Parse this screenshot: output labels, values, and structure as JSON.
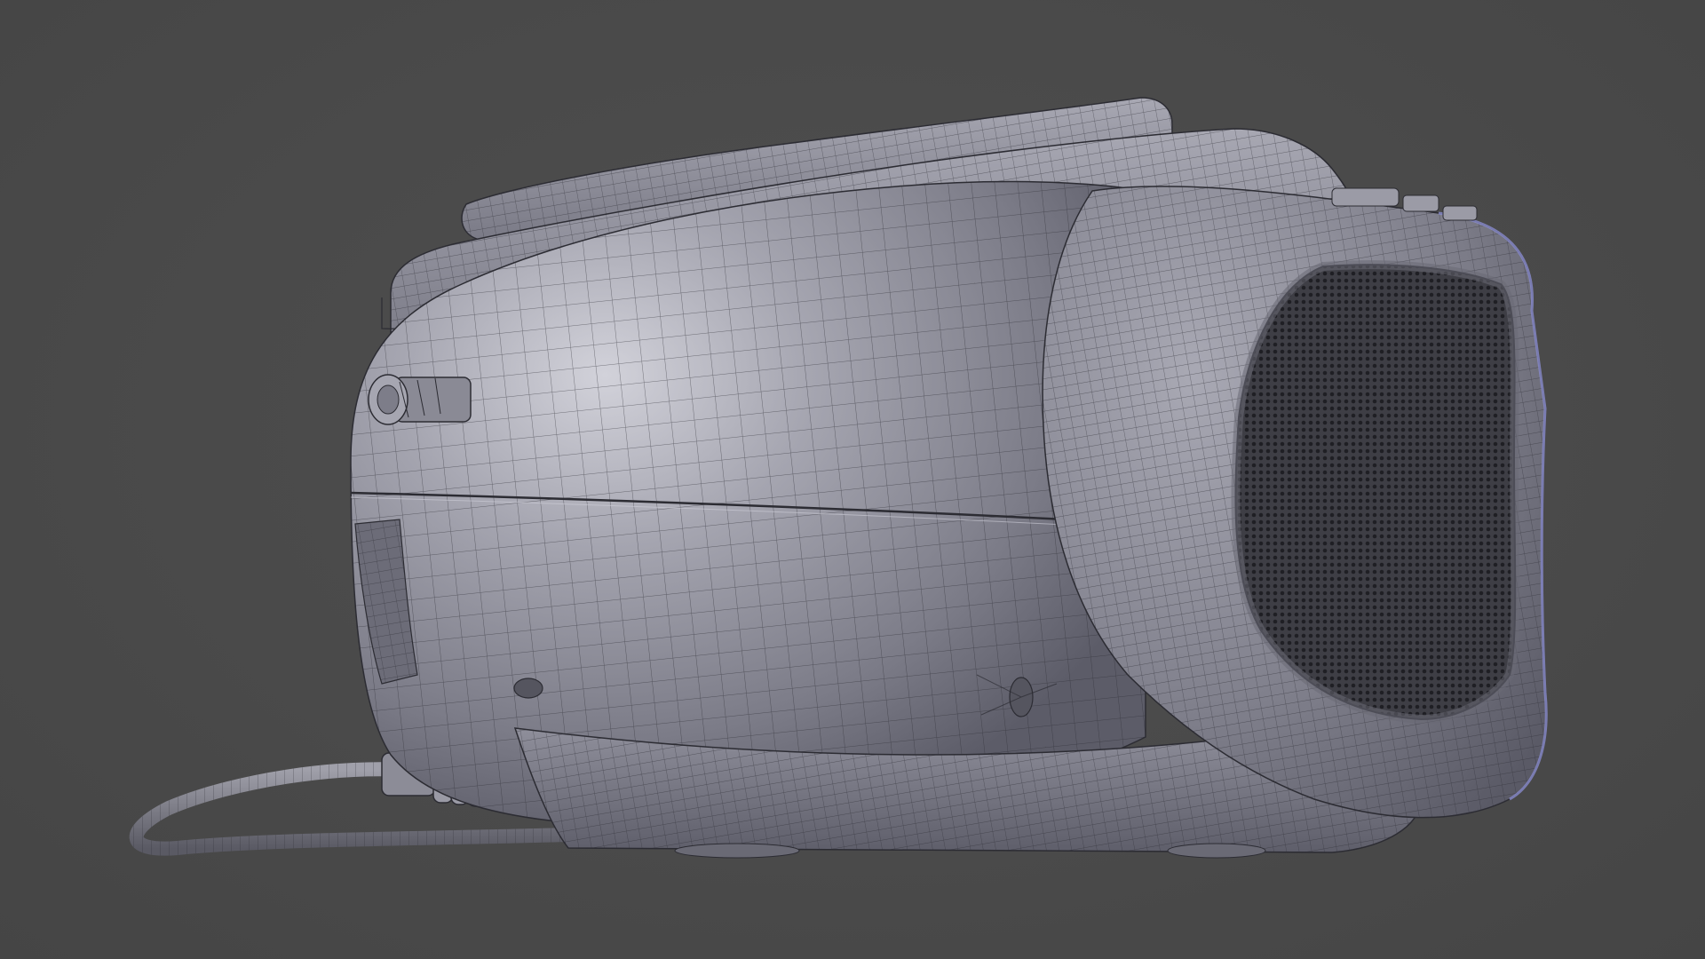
{
  "scene": {
    "subject": "boombox-wireframe",
    "colors": {
      "background": "#4a4a4a",
      "surface_light": "#b9b9c2",
      "surface_mid": "#8d8d98",
      "surface_dark": "#55555f",
      "wire": "#2c2c33",
      "speaker_grille": "#3a3a40",
      "blue_edge": "#8c8fd0"
    },
    "icons": [
      "handle-icon",
      "speaker-grille-icon",
      "knob-icon",
      "cable-icon",
      "connector-plug-icon",
      "screw-icon"
    ]
  }
}
